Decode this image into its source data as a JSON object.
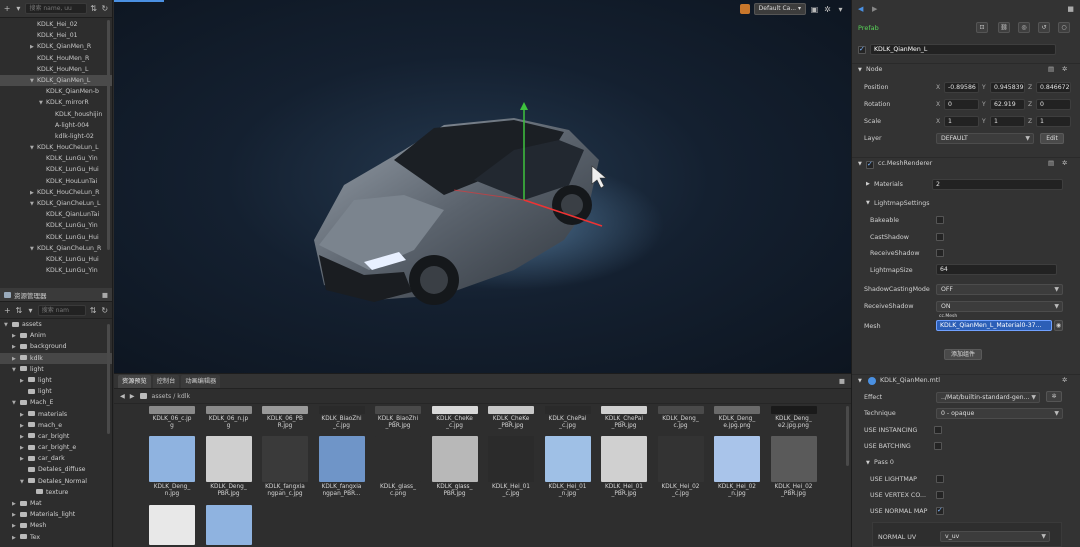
{
  "hierarchy": {
    "search_placeholder": "搜索 name, uu",
    "nodes": [
      {
        "label": "KDLK_Hei_02",
        "indent": 0,
        "arrow": ""
      },
      {
        "label": "KDLK_Hei_01",
        "indent": 0,
        "arrow": ""
      },
      {
        "label": "KDLK_QianMen_R",
        "indent": 0,
        "arrow": "▶"
      },
      {
        "label": "KDLK_HouMen_R",
        "indent": 0,
        "arrow": ""
      },
      {
        "label": "KDLK_HouMen_L",
        "indent": 0,
        "arrow": ""
      },
      {
        "label": "KDLK_QianMen_L",
        "indent": 0,
        "arrow": "▼",
        "selected": true
      },
      {
        "label": "KDLK_QianMen-b",
        "indent": 1,
        "arrow": ""
      },
      {
        "label": "KDLK_mirrorR",
        "indent": 1,
        "arrow": "▼"
      },
      {
        "label": "KDLK_houshijin",
        "indent": 2,
        "arrow": ""
      },
      {
        "label": "A-light-004",
        "indent": 2,
        "arrow": ""
      },
      {
        "label": "kdlk-light-02",
        "indent": 2,
        "arrow": ""
      },
      {
        "label": "KDLK_HouCheLun_L",
        "indent": 0,
        "arrow": "▼"
      },
      {
        "label": "KDLK_LunGu_Yin",
        "indent": 1,
        "arrow": ""
      },
      {
        "label": "KDLK_LunGu_Hui",
        "indent": 1,
        "arrow": ""
      },
      {
        "label": "KDLK_HouLunTai",
        "indent": 1,
        "arrow": ""
      },
      {
        "label": "KDLK_HouCheLun_R",
        "indent": 0,
        "arrow": "▶"
      },
      {
        "label": "KDLK_QianCheLun_L",
        "indent": 0,
        "arrow": "▼"
      },
      {
        "label": "KDLK_QianLunTai",
        "indent": 1,
        "arrow": ""
      },
      {
        "label": "KDLK_LunGu_Yin",
        "indent": 1,
        "arrow": ""
      },
      {
        "label": "KDLK_LunGu_Hui",
        "indent": 1,
        "arrow": ""
      },
      {
        "label": "KDLK_QianCheLun_R",
        "indent": 0,
        "arrow": "▼"
      },
      {
        "label": "KDLK_LunGu_Hui",
        "indent": 1,
        "arrow": ""
      },
      {
        "label": "KDLK_LunGu_Yin",
        "indent": 1,
        "arrow": ""
      }
    ]
  },
  "assets_panel": {
    "title": "资源管理器",
    "search_placeholder": "搜索 nam",
    "nodes": [
      {
        "label": "assets",
        "indent": 0,
        "arrow": "▼"
      },
      {
        "label": "Anim",
        "indent": 1,
        "arrow": "▶"
      },
      {
        "label": "background",
        "indent": 1,
        "arrow": "▶"
      },
      {
        "label": "kdlk",
        "indent": 1,
        "arrow": "▶",
        "selected": true
      },
      {
        "label": "light",
        "indent": 1,
        "arrow": "▼"
      },
      {
        "label": "light",
        "indent": 2,
        "arrow": "▶"
      },
      {
        "label": "light",
        "indent": 2,
        "arrow": ""
      },
      {
        "label": "Mach_E",
        "indent": 1,
        "arrow": "▼"
      },
      {
        "label": "materials",
        "indent": 2,
        "arrow": "▶"
      },
      {
        "label": "mach_e",
        "indent": 2,
        "arrow": "▶"
      },
      {
        "label": "car_bright",
        "indent": 2,
        "arrow": "▶"
      },
      {
        "label": "car_bright_e",
        "indent": 2,
        "arrow": "▶"
      },
      {
        "label": "car_dark",
        "indent": 2,
        "arrow": "▶"
      },
      {
        "label": "Detales_diffuse",
        "indent": 2,
        "arrow": ""
      },
      {
        "label": "Detales_Normal",
        "indent": 2,
        "arrow": "▼"
      },
      {
        "label": "texture",
        "indent": 3,
        "arrow": ""
      },
      {
        "label": "Mat",
        "indent": 1,
        "arrow": "▶"
      },
      {
        "label": "Materials_light",
        "indent": 1,
        "arrow": "▶"
      },
      {
        "label": "Mesh",
        "indent": 1,
        "arrow": "▶"
      },
      {
        "label": "Tex",
        "indent": 1,
        "arrow": "▶"
      }
    ]
  },
  "scene": {
    "camera_dropdown": "Default Ca..."
  },
  "bottom": {
    "tabs": [
      "资源预览",
      "控制台",
      "动画编辑器"
    ],
    "breadcrumb": "assets / kdlk",
    "row1": [
      {
        "l1": "KDLK_06_c.jp",
        "l2": "g"
      },
      {
        "l1": "KDLK_06_n.jp",
        "l2": "g"
      },
      {
        "l1": "KDLK_06_PB",
        "l2": "R.jpg"
      },
      {
        "l1": "KDLK_BiaoZhi",
        "l2": "_c.jpg"
      },
      {
        "l1": "KDLK_BiaoZhi",
        "l2": "_PBR.jpg"
      },
      {
        "l1": "KDLK_CheKe",
        "l2": "_c.jpg"
      },
      {
        "l1": "KDLK_CheKe",
        "l2": "_PBR.jpg"
      },
      {
        "l1": "KDLK_ChePai",
        "l2": "_c.jpg"
      },
      {
        "l1": "KDLK_ChePai",
        "l2": "_PBR.jpg"
      },
      {
        "l1": "KDLK_Deng_",
        "l2": "c.jpg"
      },
      {
        "l1": "KDLK_Deng_",
        "l2": "e.jpg.png"
      },
      {
        "l1": "KDLK_Deng_",
        "l2": "e2.jpg.png"
      }
    ],
    "row2": [
      {
        "l1": "KDLK_Deng_",
        "l2": "n.jpg"
      },
      {
        "l1": "KDLK_Deng_",
        "l2": "PBR.jpg"
      },
      {
        "l1": "KDLK_fangxia",
        "l2": "ngpan_c.jpg"
      },
      {
        "l1": "KDLK_fangxia",
        "l2": "ngpan_PBR..."
      },
      {
        "l1": "KDLK_glass_",
        "l2": "c.png"
      },
      {
        "l1": "KDLK_glass_",
        "l2": "PBR.jpg"
      },
      {
        "l1": "KDLK_Hei_01",
        "l2": "_c.jpg"
      },
      {
        "l1": "KDLK_Hei_01",
        "l2": "_n.jpg"
      },
      {
        "l1": "KDLK_Hei_01",
        "l2": "_PBR.jpg"
      },
      {
        "l1": "KDLK_Hei_02",
        "l2": "_c.jpg"
      },
      {
        "l1": "KDLK_Hei_02",
        "l2": "_n.jpg"
      },
      {
        "l1": "KDLK_Hei_02",
        "l2": "_PBR.jpg"
      }
    ]
  },
  "inspector": {
    "prefab_label": "Prefab",
    "node_name": "KDLK_QianMen_L",
    "node_section": "Node",
    "position_label": "Position",
    "position": [
      "-0.89586",
      "0.945839",
      "0.846672"
    ],
    "rotation_label": "Rotation",
    "rotation": [
      "0",
      "62.919",
      "0"
    ],
    "scale_label": "Scale",
    "scale": [
      "1",
      "1",
      "1"
    ],
    "layer_label": "Layer",
    "layer_value": "DEFAULT",
    "edit_label": "Edit",
    "axes": [
      "X",
      "Y",
      "Z"
    ],
    "mesh_renderer": "cc.MeshRenderer",
    "materials_label": "Materials",
    "materials_value": "2",
    "lightmap_section": "LightmapSettings",
    "bakeable_label": "Bakeable",
    "castshadow_label": "CastShadow",
    "receiveshadow_label": "ReceiveShadow",
    "lightmapsize_label": "LightmapSize",
    "lightmapsize_value": "64",
    "shadowcasting_label": "ShadowCastingMode",
    "shadowcasting_value": "OFF",
    "receiveshadow2_label": "ReceiveShadow",
    "receiveshadow2_value": "ON",
    "mesh_label": "Mesh",
    "mesh_tag": "cc.Mesh",
    "mesh_value": "KDLK_QianMen_L_Material0-37...",
    "add_component": "添加组件",
    "material_name": "KDLK_QianMen.mtl",
    "effect_label": "Effect",
    "effect_value": "../Mat/builtin-standard-gen...",
    "technique_label": "Technique",
    "technique_value": "0 - opaque",
    "use_instancing": "USE INSTANCING",
    "use_batching": "USE BATCHING",
    "pass_label": "Pass 0",
    "use_lightmap": "USE LIGHTMAP",
    "use_vertex_color": "USE VERTEX CO...",
    "use_normal_map": "USE NORMAL MAP",
    "normal_uv_label": "NORMAL UV",
    "normal_uv_value": "v_uv"
  }
}
